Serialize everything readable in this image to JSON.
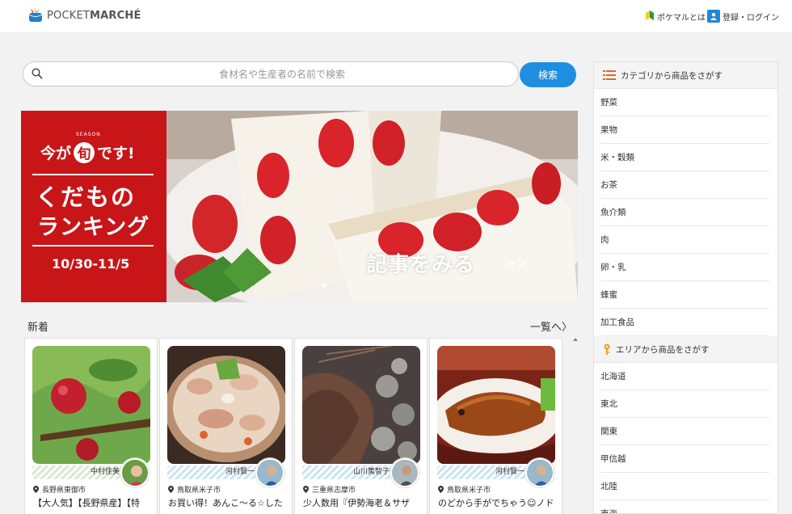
{
  "header": {
    "logo_text_light": "POCKET",
    "logo_text_bold": "MARCHÉ",
    "about_link": "ポケマルとは",
    "login_link": "登録・ログイン"
  },
  "search": {
    "placeholder": "食材名や生産者の名前で検索",
    "button_label": "検索"
  },
  "banner": {
    "season_prefix": "今が",
    "season_char": "旬",
    "season_suffix": "です!",
    "season_tag": "SEASON",
    "title_line1": "くだもの",
    "title_line2": "ランキング",
    "dates": "10/30-11/5",
    "cta": "記事をみる",
    "cta_arrow": ">>"
  },
  "new_section": {
    "title": "新着",
    "see_all": "一覧へ〉",
    "cards": [
      {
        "producer": "中村佳美",
        "location": "長野県東御市",
        "title": "【大人気】【長野県産】【特"
      },
      {
        "producer": "河村賢一",
        "location": "鳥取県米子市",
        "title": "お買い得！あんこ〜る☆した"
      },
      {
        "producer": "山川篤智子",
        "location": "三重県志摩市",
        "title": "少人数用『伊勢海老＆サザ"
      },
      {
        "producer": "河村賢一",
        "location": "鳥取県米子市",
        "title": "のどから手がでちゃう☺ノド"
      }
    ]
  },
  "sidebar": {
    "category_heading": "カテゴリから商品をさがす",
    "categories": [
      "野菜",
      "果物",
      "米・穀類",
      "お茶",
      "魚介類",
      "肉",
      "卵・乳",
      "蜂蜜",
      "加工食品"
    ],
    "area_heading": "エリアから商品をさがす",
    "areas": [
      "北海道",
      "東北",
      "関東",
      "甲信越",
      "北陸",
      "東海"
    ]
  },
  "colors": {
    "accent": "#1e8ee0",
    "banner_red": "#c81518",
    "category_icon": "#e8641e",
    "area_icon": "#f0a020"
  }
}
